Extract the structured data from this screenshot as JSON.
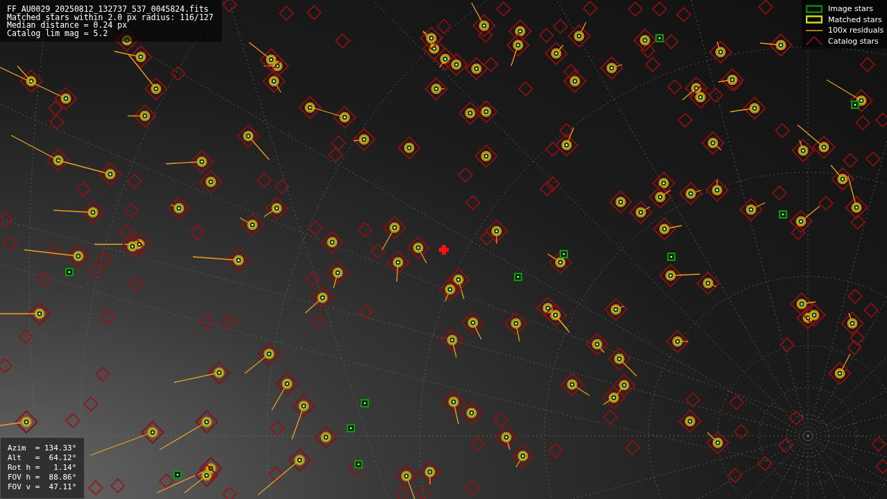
{
  "header": {
    "lines": [
      "FF_AU0029_20250812_132737_537_0045824.fits",
      "Matched stars within 2.0 px radius: 116/127",
      "Median distance = 0.24 px",
      "Catalog lim mag = 5.2"
    ]
  },
  "legend": [
    {
      "kind": "image",
      "label": "Image stars"
    },
    {
      "kind": "matched",
      "label": "Matched stars"
    },
    {
      "kind": "residual",
      "label": "100x residuals"
    },
    {
      "kind": "catalog",
      "label": "Catalog stars"
    }
  ],
  "pointing": {
    "lines": [
      "Azim  = 134.33°",
      "Alt   =  64.12°",
      "Rot h =   1.14°",
      "FOV h =  88.86°",
      "FOV v =  47.11°"
    ]
  }
}
